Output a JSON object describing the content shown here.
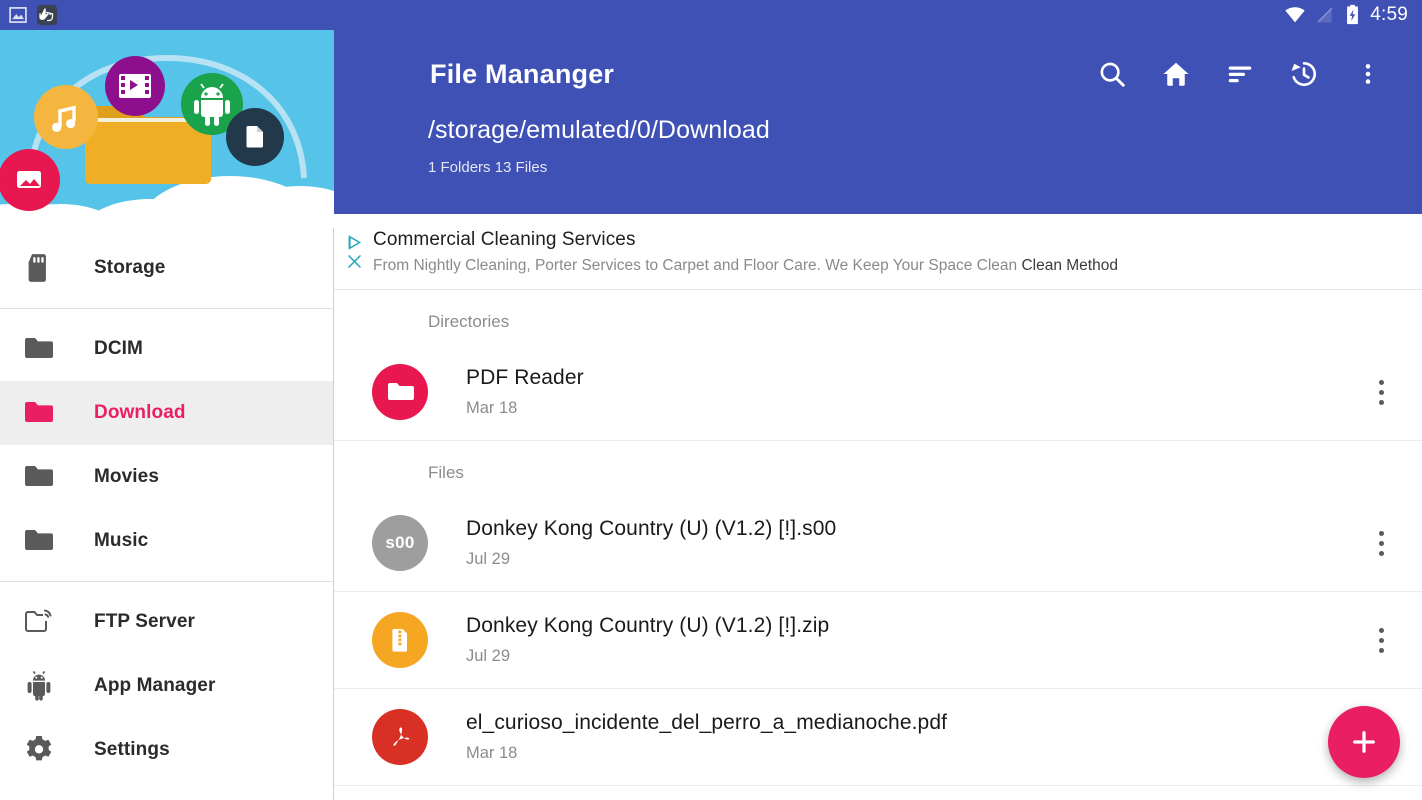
{
  "statusbar": {
    "time": "4:59",
    "left_icons": [
      "screenshot-icon",
      "touch-pointer-icon"
    ],
    "right_icons": [
      "wifi-icon",
      "signal-off-icon",
      "battery-charging-icon"
    ]
  },
  "colors": {
    "primary": "#3f51b5",
    "accent": "#e91e63",
    "drawer_header_sky": "#56c3e8",
    "folder_yellow": "#f0ad26",
    "zip_orange": "#f5a623",
    "pdf_red": "#d93025",
    "s00_gray": "#9e9e9e",
    "ad_teal": "#2aa9bf"
  },
  "drawer": {
    "header": {
      "name": "drawer-header-illustration",
      "bubbles": [
        {
          "name": "image-bubble",
          "color": "#e8174f",
          "icon": "image-icon"
        },
        {
          "name": "music-bubble",
          "color": "#f5b63f",
          "icon": "music-note-icon"
        },
        {
          "name": "video-bubble",
          "color": "#8e0f8e",
          "icon": "film-icon"
        },
        {
          "name": "android-bubble",
          "color": "#1aa34a",
          "icon": "android-icon"
        },
        {
          "name": "document-bubble",
          "color": "#22384b",
          "icon": "document-icon"
        }
      ]
    },
    "groups": [
      {
        "items": [
          {
            "label": "Storage",
            "icon": "sd-card-icon",
            "active": false
          }
        ]
      },
      {
        "items": [
          {
            "label": "DCIM",
            "icon": "folder-icon",
            "active": false
          },
          {
            "label": "Download",
            "icon": "folder-icon",
            "active": true
          },
          {
            "label": "Movies",
            "icon": "folder-icon",
            "active": false
          },
          {
            "label": "Music",
            "icon": "folder-icon",
            "active": false
          }
        ]
      },
      {
        "items": [
          {
            "label": "FTP Server",
            "icon": "folder-wifi-icon",
            "active": false
          },
          {
            "label": "App Manager",
            "icon": "android-icon",
            "active": false
          },
          {
            "label": "Settings",
            "icon": "gear-icon",
            "active": false
          }
        ]
      }
    ]
  },
  "appbar": {
    "title": "File Mananger",
    "path": "/storage/emulated/0/Download",
    "summary": "1 Folders 13 Files",
    "actions": [
      {
        "name": "search-icon",
        "label": "Search"
      },
      {
        "name": "home-icon",
        "label": "Home"
      },
      {
        "name": "sort-icon",
        "label": "Sort"
      },
      {
        "name": "history-icon",
        "label": "History"
      },
      {
        "name": "overflow-menu-icon",
        "label": "More options"
      }
    ]
  },
  "ad": {
    "title": "Commercial Cleaning Services",
    "description": "From Nightly Cleaning, Porter Services to Carpet and Floor Care. We Keep Your Space Clean ",
    "advertiser": "Clean Method",
    "badges": [
      "adchoices-icon",
      "close-icon"
    ]
  },
  "list": {
    "sections": [
      {
        "heading": "Directories",
        "items": [
          {
            "name": "PDF Reader",
            "date": "Mar 18",
            "icon": "folder-round-icon",
            "icon_color": "#e8174f",
            "icon_text": ""
          }
        ]
      },
      {
        "heading": "Files",
        "items": [
          {
            "name": "Donkey Kong Country (U) (V1.2) [!].s00",
            "date": "Jul 29",
            "icon": "generic-file-icon",
            "icon_color": "#9e9e9e",
            "icon_text": "s00"
          },
          {
            "name": "Donkey Kong Country (U) (V1.2) [!].zip",
            "date": "Jul 29",
            "icon": "zip-archive-icon",
            "icon_color": "#f5a623",
            "icon_text": ""
          },
          {
            "name": "el_curioso_incidente_del_perro_a_medianoche.pdf",
            "date": "Mar 18",
            "icon": "pdf-file-icon",
            "icon_color": "#d93025",
            "icon_text": ""
          }
        ]
      }
    ]
  },
  "fab": {
    "name": "add-button",
    "icon": "plus-icon",
    "label": "+"
  }
}
